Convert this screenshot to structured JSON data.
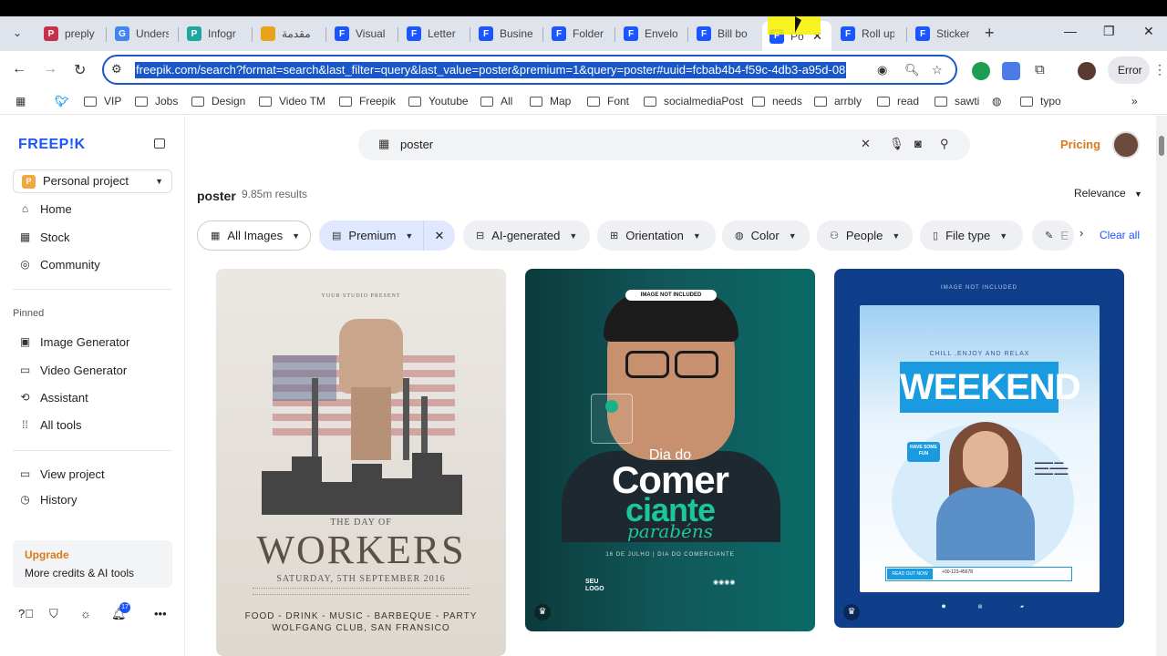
{
  "browser": {
    "tabs": [
      {
        "title": "preply",
        "color": "#c7304a",
        "glyph": "P"
      },
      {
        "title": "Unders",
        "color": "#4285f4",
        "glyph": "G"
      },
      {
        "title": "Infogr",
        "color": "#1ea7a0",
        "glyph": "P"
      },
      {
        "title": "مقدمة",
        "color": "#e9a21a",
        "glyph": ""
      },
      {
        "title": "Visual",
        "color": "#1a55ff",
        "glyph": "F"
      },
      {
        "title": "Letter",
        "color": "#1a55ff",
        "glyph": "F"
      },
      {
        "title": "Busine",
        "color": "#1a55ff",
        "glyph": "F"
      },
      {
        "title": "Folder",
        "color": "#1a55ff",
        "glyph": "F"
      },
      {
        "title": "Envelo",
        "color": "#1a55ff",
        "glyph": "F"
      },
      {
        "title": "Bill bo",
        "color": "#1a55ff",
        "glyph": "F"
      },
      {
        "title": "Po",
        "color": "#1a55ff",
        "glyph": "F",
        "active": true
      },
      {
        "title": "Roll up",
        "color": "#1a55ff",
        "glyph": "F"
      },
      {
        "title": "Sticker",
        "color": "#1a55ff",
        "glyph": "F"
      }
    ],
    "new_tab": "+",
    "url": "freepik.com/search?format=search&last_filter=query&last_value=poster&premium=1&query=poster#uuid=fcbab4b4-f59c-4db3-a95d-08",
    "error_label": "Error",
    "bookmarks": [
      "VIP",
      "Jobs",
      "Design",
      "Video TM",
      "Freepik",
      "Youtube",
      "All",
      "Map",
      "Font",
      "socialmediaPost",
      "needs",
      "arrbly",
      "read",
      "sawti",
      "typo"
    ]
  },
  "sidebar": {
    "logo": "FREEP!K",
    "project": "Personal project",
    "project_badge": "P",
    "nav": [
      "Home",
      "Stock",
      "Community"
    ],
    "pinned_label": "Pinned",
    "pinned": [
      "Image Generator",
      "Video Generator",
      "Assistant",
      "All tools"
    ],
    "more": [
      "View project",
      "History"
    ],
    "upgrade_title": "Upgrade",
    "upgrade_text": "More credits & AI tools",
    "notifications": "17"
  },
  "header": {
    "search_query": "poster",
    "pricing": "Pricing"
  },
  "results": {
    "title": "poster",
    "count": "9.85m results",
    "sort": "Relevance",
    "filters": [
      "All Images",
      "Premium",
      "AI-generated",
      "Orientation",
      "Color",
      "People",
      "File type",
      "E"
    ],
    "clear_all": "Clear all"
  },
  "cards": {
    "c1": {
      "studio": "YOUR STUDIO PRESENT",
      "the": "THE DAY OF",
      "title": "WORKERS",
      "date": "SATURDAY, 5TH SEPTEMBER 2016",
      "items": "FOOD - DRINK - MUSIC - BARBEQUE - PARTY",
      "venue": "WOLFGANG CLUB, SAN FRANSICO"
    },
    "c2": {
      "pill": "IMAGE NOT INCLUDED",
      "dia": "Dia do",
      "comer": "Comer",
      "ciante": "ciante",
      "parabens": "parabéns",
      "date": "16 DE JULHO | DIA DO COMERCIANTE",
      "logo": "SEU LOGO"
    },
    "c3": {
      "small": "IMAGE NOT INCLUDED",
      "chill": "CHILL ,ENJOY AND RELAX",
      "weekend": "WEEKEND",
      "fun": "HAVE SOME FUN",
      "btn": "READ OUT NOW",
      "phone": "+00-123-45678"
    }
  }
}
